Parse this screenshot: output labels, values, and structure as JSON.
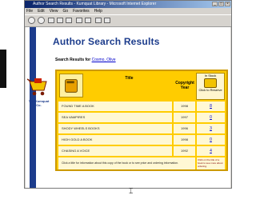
{
  "window": {
    "title": "Author Search Results - Kumquat Library - Microsoft Internet Explorer",
    "min_icon": "minimize-icon",
    "max_icon": "maximize-icon",
    "close_icon": "close-icon"
  },
  "menu": {
    "items": [
      "File",
      "Edit",
      "View",
      "Go",
      "Favorites",
      "Help"
    ]
  },
  "toolbar": {
    "icons": [
      "back-icon",
      "forward-icon",
      "stop-icon",
      "refresh-icon",
      "home-icon",
      "search-icon",
      "favorites-icon",
      "print-icon",
      "mail-icon"
    ]
  },
  "page": {
    "heading": "Author Search Results",
    "subline_prefix": "Search Results for",
    "author": "Cosmo, Olive",
    "logo_text": "The Kumquat Co.",
    "logo_icon": "shopping-cart-icon"
  },
  "table": {
    "headers": {
      "title": "Title",
      "copyright": "Copyright Year",
      "stock": "In Stock",
      "stock_note": "Click to Reserve"
    },
    "rows": [
      {
        "title": "FOUND TIME A BOOK",
        "year": "1998",
        "stock": "8"
      },
      {
        "title": "SEA VAMPIRES",
        "year": "1997",
        "stock": "0"
      },
      {
        "title": "SHODY WHEELS BOOKS",
        "year": "1996",
        "stock": "3"
      },
      {
        "title": "HIGH GOLD A BOOK",
        "year": "1998",
        "stock": "0"
      },
      {
        "title": "CHASING A VOICE",
        "year": "1992",
        "stock": "4"
      }
    ],
    "footer_note": "Click a title for information about this copy of the book or to see price and ordering information.",
    "footer_side": "Click on the title of a book to see more about ordering."
  },
  "colors": {
    "brand": "#1c3c8c",
    "table_bg": "#ffcc00",
    "link": "#0000cc"
  }
}
